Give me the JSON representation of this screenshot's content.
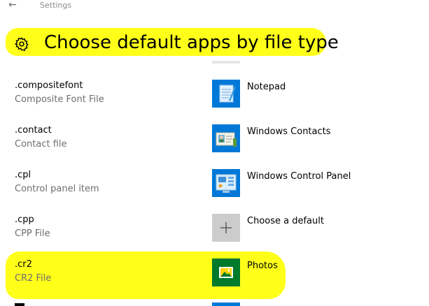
{
  "window": {
    "title": "Settings"
  },
  "page": {
    "title": "Choose default apps by file type"
  },
  "rows": [
    {
      "ext": ".compositefont",
      "desc": "Composite Font File",
      "app": "Notepad",
      "tile_color": "#0078d7",
      "icon": "notepad-icon"
    },
    {
      "ext": ".contact",
      "desc": "Contact file",
      "app": "Windows Contacts",
      "tile_color": "#0078d7",
      "icon": "contacts-icon"
    },
    {
      "ext": ".cpl",
      "desc": "Control panel item",
      "app": "Windows Control Panel",
      "tile_color": "#0078d7",
      "icon": "control-panel-icon"
    },
    {
      "ext": ".cpp",
      "desc": "CPP File",
      "app": "Choose a default",
      "tile_color": "#cccccc",
      "icon": "plus-icon"
    },
    {
      "ext": ".cr2",
      "desc": "CR2 File",
      "app": "Photos",
      "tile_color": "#007a2b",
      "icon": "photos-icon"
    }
  ],
  "colors": {
    "highlight": "#ffff1a",
    "accent": "#0078d7"
  }
}
